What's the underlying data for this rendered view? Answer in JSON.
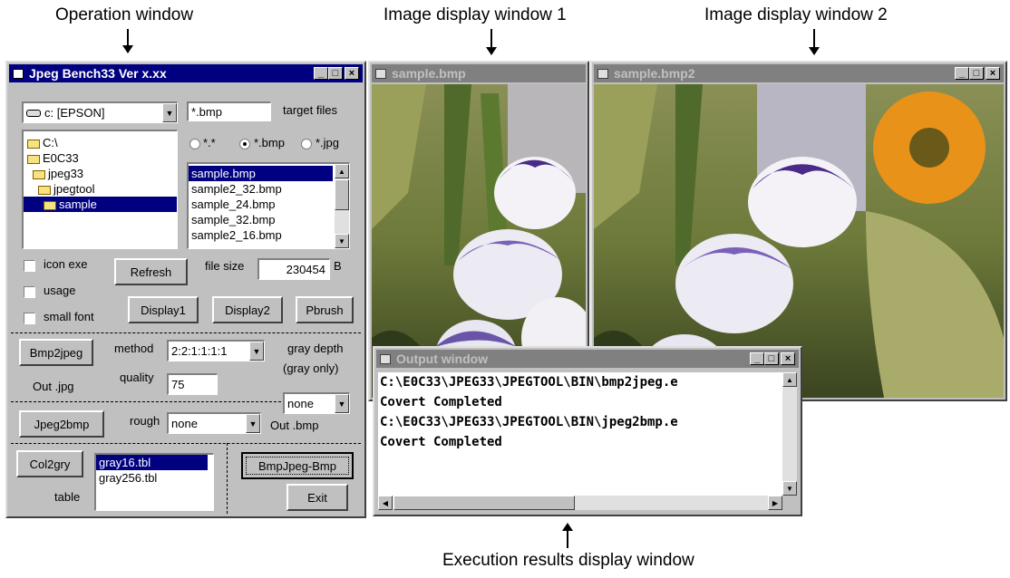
{
  "captions": {
    "operation": "Operation window",
    "display1": "Image display window 1",
    "display2": "Image display window 2",
    "execution": "Execution results display window"
  },
  "op_window": {
    "title": "Jpeg Bench33 Ver x.xx",
    "drive": "c: [EPSON]",
    "target_value": "*.bmp",
    "target_label": "target files",
    "radios": [
      {
        "label": "*.*",
        "selected": false
      },
      {
        "label": "*.bmp",
        "selected": true
      },
      {
        "label": "*.jpg",
        "selected": false
      }
    ],
    "folders": [
      "C:\\",
      "E0C33",
      "jpeg33",
      "jpegtool",
      "sample"
    ],
    "files": [
      "sample.bmp",
      "sample2_32.bmp",
      "sample_24.bmp",
      "sample_32.bmp",
      "sample2_16.bmp"
    ],
    "checks": [
      "icon exe",
      "usage",
      "small font"
    ],
    "refresh": "Refresh",
    "filesize_label": "file size",
    "filesize_value": "230454",
    "filesize_unit": "B",
    "display1": "Display1",
    "display2": "Display2",
    "pbrush": "Pbrush",
    "bmp2jpeg": "Bmp2jpeg",
    "method_label": "method",
    "method_value": "2:2:1:1:1:1",
    "gray_depth": "gray depth",
    "gray_only": "(gray only)",
    "out_jpg": "Out .jpg",
    "quality_label": "quality",
    "quality_value": "75",
    "none_value": "none",
    "jpeg2bmp": "Jpeg2bmp",
    "rough_label": "rough",
    "rough_value": "none",
    "out_bmp": "Out .bmp",
    "col2gry": "Col2gry",
    "tables": [
      "gray16.tbl",
      "gray256.tbl"
    ],
    "table_label": "table",
    "bmpjpegbmp": "BmpJpeg-Bmp",
    "exit": "Exit"
  },
  "img1": {
    "title": "sample.bmp"
  },
  "img2": {
    "title": "sample.bmp2"
  },
  "output": {
    "title": "Output window",
    "lines": [
      "C:\\E0C33\\JPEG33\\JPEGTOOL\\BIN\\bmp2jpeg.e",
      "Covert Completed",
      "C:\\E0C33\\JPEG33\\JPEGTOOL\\BIN\\jpeg2bmp.e",
      "Covert Completed"
    ]
  },
  "colors": {
    "title_active": "#000080",
    "title_inactive": "#808080",
    "face": "#c0c0c0"
  }
}
